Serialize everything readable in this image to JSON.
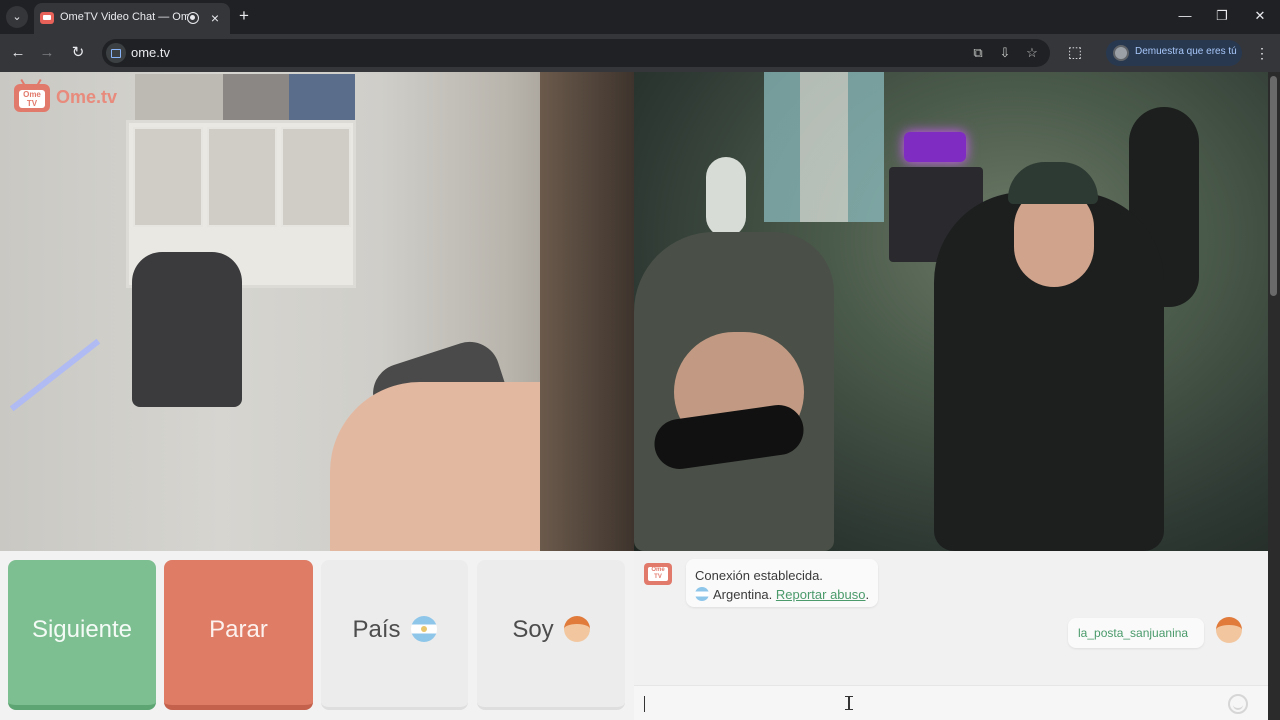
{
  "browser": {
    "tab_title": "OmeTV Video Chat — Ome",
    "url": "ome.tv",
    "profile_label": "Demuestra que eres tú",
    "window_controls": {
      "minimize": "—",
      "maximize": "❐",
      "close": "✕"
    },
    "icons": [
      "tab-search-icon",
      "recording-icon",
      "close-icon",
      "new-tab-icon",
      "back-icon",
      "forward-icon",
      "reload-icon",
      "site-info-icon",
      "translate-icon",
      "install-icon",
      "bookmark-star-icon",
      "extensions-icon",
      "profile-icon",
      "more-menu-icon"
    ]
  },
  "page": {
    "logo_text": "Ome.tv",
    "logo_badge": "Ome TV",
    "controls": {
      "next": "Siguiente",
      "stop": "Parar",
      "country": "País",
      "gender": "Soy"
    },
    "chat": {
      "system_line1": "Conexión establecida.",
      "country_name": "Argentina.",
      "report_link": "Reportar abuso",
      "report_suffix": ".",
      "partner_name": "la_posta_sanjuanina"
    },
    "colors": {
      "next_button": "#7ebf91",
      "stop_button": "#de7c66",
      "link_green": "#4a9a6b",
      "brand": "#e27a6c"
    }
  }
}
